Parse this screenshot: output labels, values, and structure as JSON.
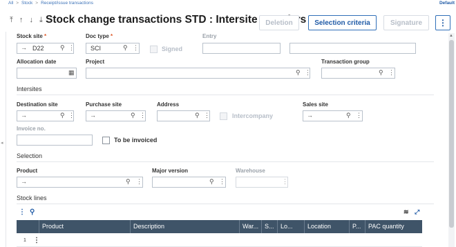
{
  "breadcrumb": [
    "All",
    "Stock",
    "Receipt/issue transactions"
  ],
  "default_label": "Default",
  "header": {
    "nav_arrows": "⤒ ↑ ↓ ⤓",
    "title": "Stock change transactions STD : Intersite transfers",
    "buttons": {
      "deletion": "Deletion",
      "selection_criteria": "Selection criteria",
      "signature": "Signature",
      "more": "⋮"
    }
  },
  "form": {
    "stock_site": {
      "label": "Stock site",
      "value": "D22"
    },
    "doc_type": {
      "label": "Doc type",
      "value": "SCI"
    },
    "signed": {
      "label": "Signed"
    },
    "entry": {
      "label": "Entry",
      "value": "",
      "value2": ""
    },
    "allocation_date": {
      "label": "Allocation date",
      "value": ""
    },
    "project": {
      "label": "Project",
      "value": ""
    },
    "transaction_group": {
      "label": "Transaction group",
      "value": ""
    }
  },
  "intersites": {
    "title": "Intersites",
    "destination_site": {
      "label": "Destination site",
      "value": ""
    },
    "purchase_site": {
      "label": "Purchase site",
      "value": ""
    },
    "address": {
      "label": "Address",
      "value": ""
    },
    "intercompany": {
      "label": "Intercompany"
    },
    "sales_site": {
      "label": "Sales site",
      "value": ""
    },
    "invoice_no": {
      "label": "Invoice no.",
      "value": ""
    },
    "to_be_invoiced": {
      "label": "To be invoiced"
    }
  },
  "selection": {
    "title": "Selection",
    "product": {
      "label": "Product",
      "value": ""
    },
    "major_version": {
      "label": "Major version",
      "value": ""
    },
    "warehouse": {
      "label": "Warehouse",
      "value": ""
    }
  },
  "stock_lines": {
    "title": "Stock lines",
    "columns": [
      "Product",
      "Description",
      "War...",
      "S...",
      "Lo...",
      "Location",
      "P...",
      "PAC quantity"
    ],
    "rows": [
      {
        "num": "1"
      }
    ]
  },
  "icons": {
    "arrow": "→",
    "search": "⚲",
    "menu": "⋮",
    "calendar": "▦"
  }
}
